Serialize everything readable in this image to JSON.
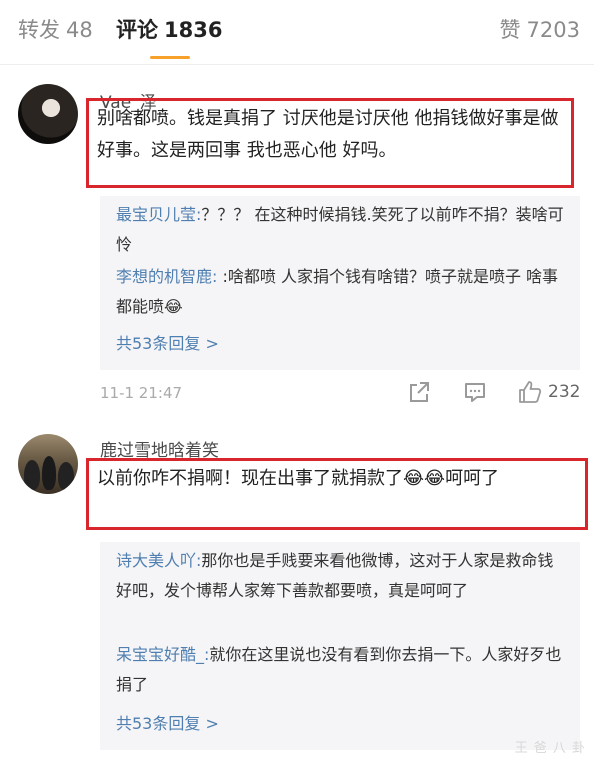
{
  "tabs": {
    "repost_label": "转发",
    "repost_count": "48",
    "comment_label": "评论",
    "comment_count": "1836",
    "like_label": "赞",
    "like_count": "7203"
  },
  "comments": [
    {
      "username": "Vae_泽",
      "text": "别啥都喷。钱是真捐了 讨厌他是讨厌他 他捐钱做好事是做好事。这是两回事 我也恶心他 好吗。",
      "replies": [
        {
          "name": "最宝贝儿莹:",
          "text": "？？？ 在这种时候捐钱.笑死了以前咋不捐？装啥可怜"
        },
        {
          "name": "李想的机智鹿:",
          "text": " :啥都喷 人家捐个钱有啥错？喷子就是喷子 啥事都能喷😂"
        }
      ],
      "more_replies": "共53条回复 >",
      "time": "11-1 21:47",
      "like_count": "232"
    },
    {
      "username": "鹿过雪地晗着笑",
      "text": "以前你咋不捐啊！现在出事了就捐款了😂😂呵呵了",
      "replies": [
        {
          "name": "诗大美人吖:",
          "text": "那你也是手贱要来看他微博，这对于人家是救命钱好吧，发个博帮人家筹下善款都要喷，真是呵呵了"
        },
        {
          "name": "呆宝宝好酷_:",
          "text": "就你在这里说也没有看到你去捐一下。人家好歹也捐了"
        }
      ],
      "more_replies": "共53条回复 >"
    }
  ],
  "watermark": "王 爸 八 卦",
  "icons": [
    "share-icon",
    "comment-icon",
    "like-icon"
  ],
  "colors": {
    "accent": "#f7a12b",
    "highlight_box": "#d9262c",
    "link": "#4f7fb0"
  }
}
